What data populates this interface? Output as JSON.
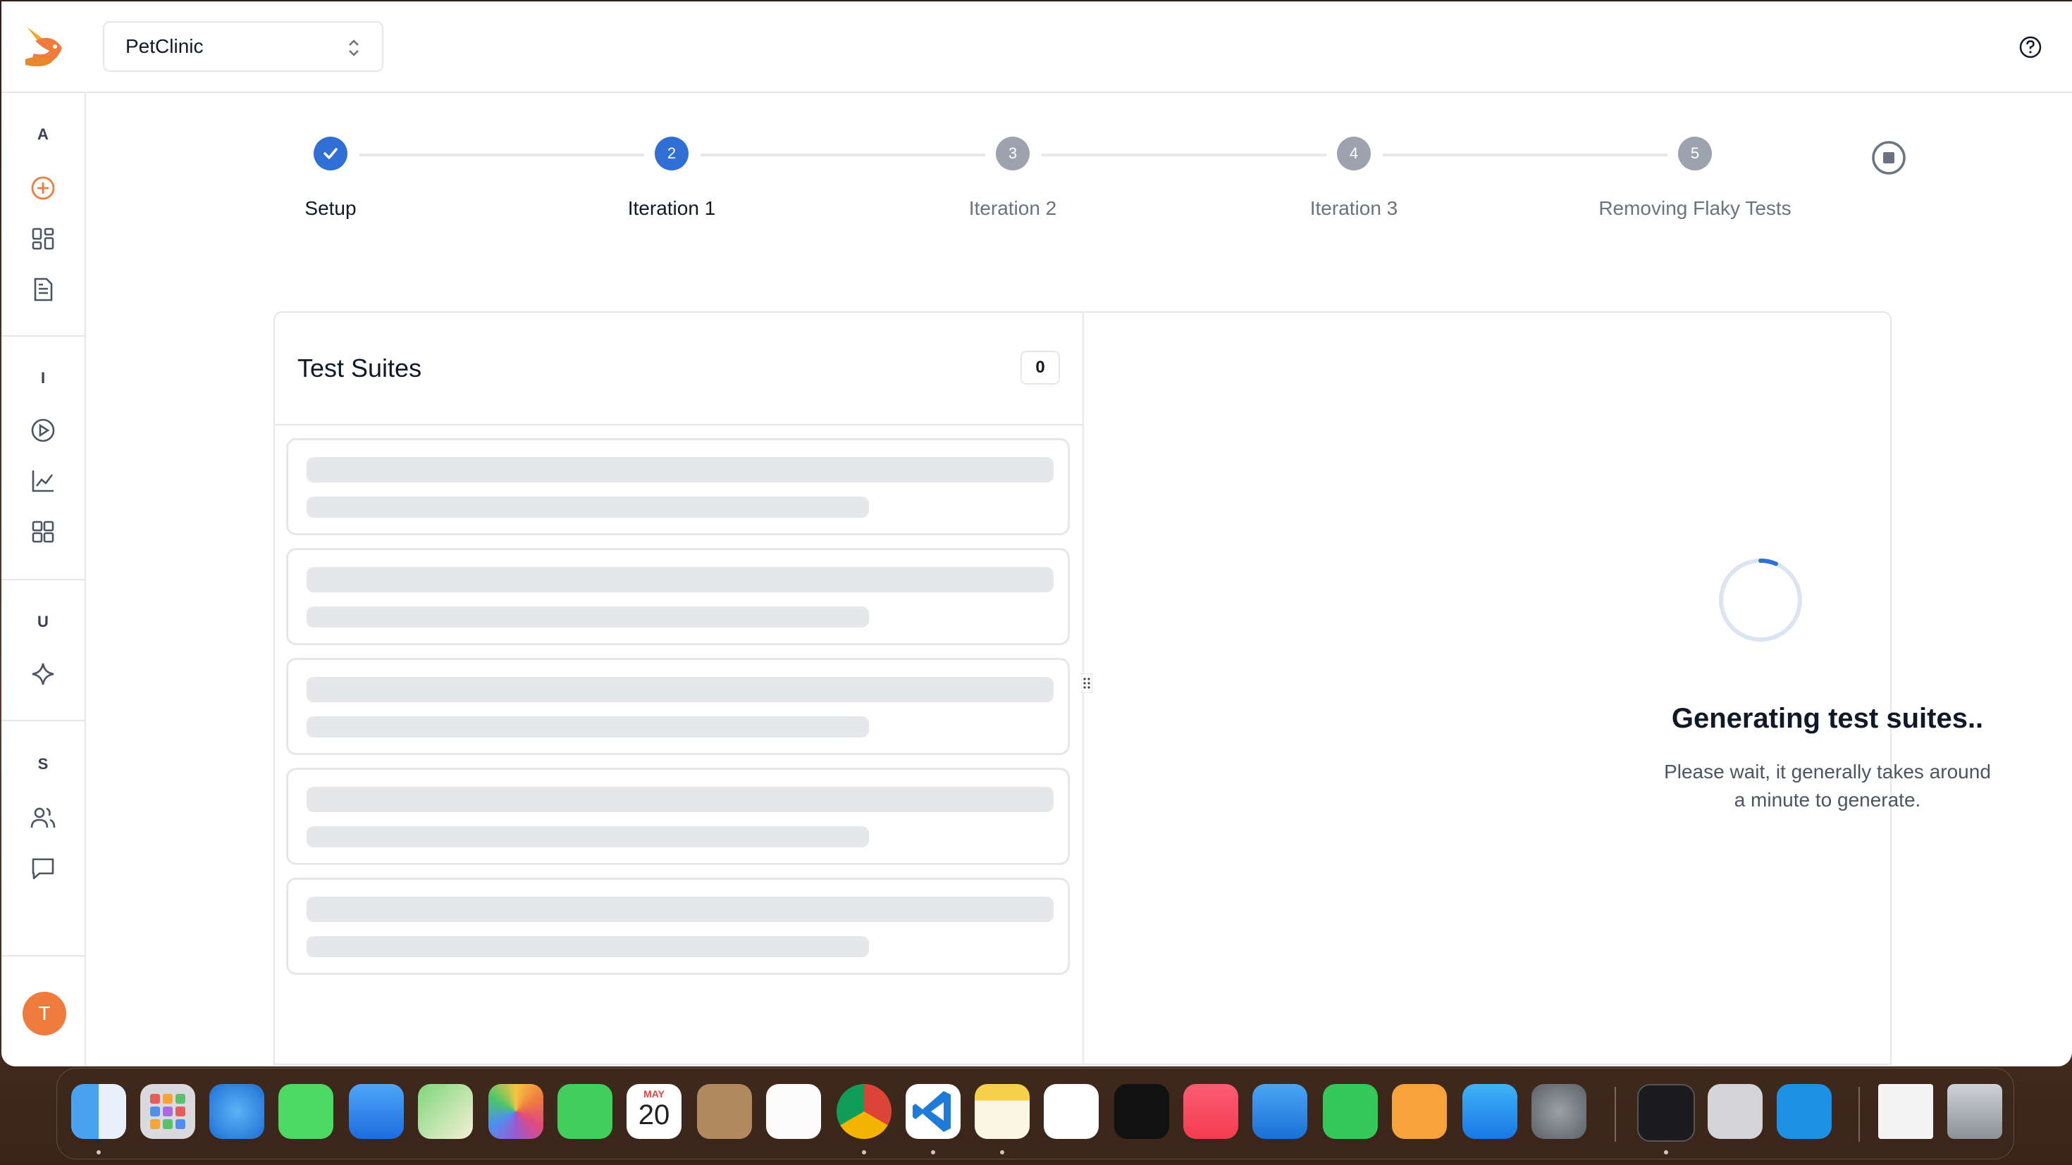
{
  "app": {
    "project_name": "PetClinic",
    "colors": {
      "accent": "#2f6fd6",
      "brand_orange": "#f07b3f",
      "muted_step": "#9ca3af"
    }
  },
  "sidebar": {
    "sections": [
      {
        "letter": "A",
        "items": [
          "plus-circle-icon",
          "dashboard-icon",
          "document-icon"
        ]
      },
      {
        "letter": "I",
        "items": [
          "play-circle-icon",
          "chart-line-icon",
          "grid-icon"
        ]
      },
      {
        "letter": "U",
        "items": [
          "sparkle-icon"
        ]
      },
      {
        "letter": "S",
        "items": [
          "users-icon",
          "chat-icon"
        ]
      }
    ],
    "avatar_initial": "T"
  },
  "stepper": {
    "steps": [
      {
        "label": "Setup",
        "number": "",
        "state": "done"
      },
      {
        "label": "Iteration 1",
        "number": "2",
        "state": "active"
      },
      {
        "label": "Iteration 2",
        "number": "3",
        "state": "pending"
      },
      {
        "label": "Iteration 3",
        "number": "4",
        "state": "pending"
      },
      {
        "label": "Removing Flaky Tests",
        "number": "5",
        "state": "pending"
      }
    ],
    "stop_icon": "stop-circle-icon"
  },
  "test_suites": {
    "title": "Test Suites",
    "count": "0",
    "skeleton_rows": 5
  },
  "generating": {
    "title": "Generating test suites..",
    "line1": "Please wait, it generally takes around",
    "line2": "a minute to generate."
  },
  "dock": {
    "apps": [
      "finder-icon",
      "launchpad-icon",
      "safari-icon",
      "messages-icon",
      "mail-icon",
      "maps-icon",
      "photos-icon",
      "facetime-icon",
      "calendar-icon",
      "contacts-icon",
      "reminders-icon",
      "chrome-icon",
      "vscode-icon",
      "notes-icon",
      "freeform-icon",
      "appletv-icon",
      "music-icon",
      "keynote-icon",
      "numbers-icon",
      "pages-icon",
      "appstore-icon",
      "settings-icon",
      "terminal-icon",
      "fontbook-icon",
      "docker-icon",
      "document-preview-icon",
      "trash-icon"
    ],
    "calendar_month": "MAY",
    "calendar_day": "20"
  }
}
